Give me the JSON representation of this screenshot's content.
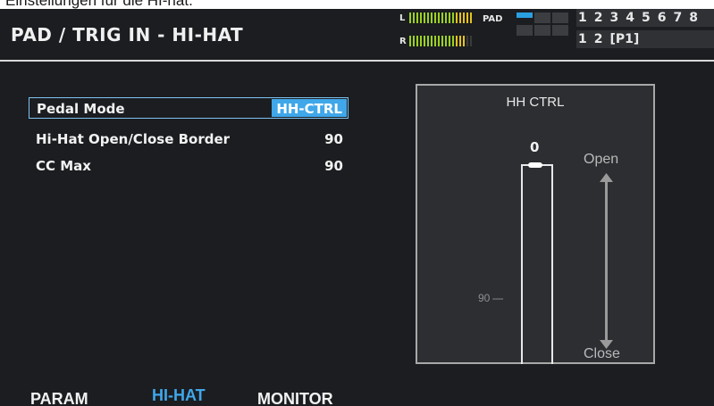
{
  "caption": "Einstellungen für die HI-hat.",
  "header": {
    "title": "PAD / TRIG IN - HI-HAT",
    "meter_left_label": "L",
    "meter_right_label": "R",
    "pad_label": "PAD",
    "banks_row1": [
      "1",
      "2",
      "3",
      "4",
      "5",
      "6",
      "7",
      "8"
    ],
    "banks_row2": [
      "1",
      "2"
    ],
    "patch": "[P1]"
  },
  "params": [
    {
      "label": "Pedal Mode",
      "value": "HH-CTRL",
      "selected": true
    },
    {
      "label": "Hi-Hat Open/Close Border",
      "value": "90"
    },
    {
      "label": "CC Max",
      "value": "90"
    }
  ],
  "hh_panel": {
    "title": "HH CTRL",
    "current_value": "0",
    "border_value": "90",
    "open_label": "Open",
    "close_label": "Close"
  },
  "tabs": [
    {
      "label": "PARAM",
      "active": false
    },
    {
      "label": "HI-HAT",
      "active": true
    },
    {
      "label": "MONITOR",
      "active": false
    }
  ],
  "colors": {
    "accent": "#3fa7ea",
    "meter_green": "#9bd21f",
    "meter_yellow": "#e6c21a",
    "background": "#1b1d20"
  }
}
